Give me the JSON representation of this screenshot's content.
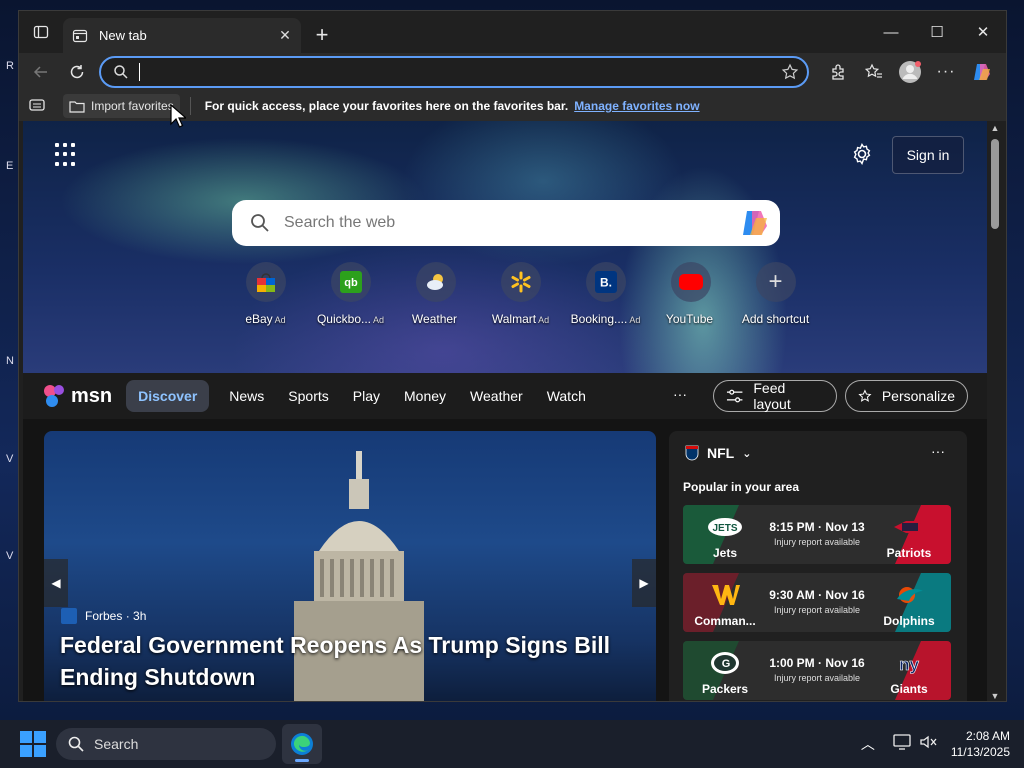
{
  "browser": {
    "tab_title": "New tab",
    "address_value": ""
  },
  "favorites_bar": {
    "import_label": "Import favorites",
    "message": "For quick access, place your favorites here on the favorites bar.",
    "manage_link": "Manage favorites now"
  },
  "newtab": {
    "signin_label": "Sign in",
    "search_placeholder": "Search the web",
    "shortcuts": [
      {
        "label": "eBay",
        "ad": "Ad"
      },
      {
        "label": "Quickbo...",
        "ad": "Ad"
      },
      {
        "label": "Weather",
        "ad": ""
      },
      {
        "label": "Walmart",
        "ad": "Ad"
      },
      {
        "label": "Booking....",
        "ad": "Ad"
      },
      {
        "label": "YouTube",
        "ad": ""
      },
      {
        "label": "Add shortcut",
        "ad": ""
      }
    ]
  },
  "msn": {
    "logo_text": "msn",
    "tabs": [
      "Discover",
      "News",
      "Sports",
      "Play",
      "Money",
      "Weather",
      "Watch"
    ],
    "more": "···",
    "feed_layout": "Feed layout",
    "personalize": "Personalize"
  },
  "hero_story": {
    "source": "Forbes",
    "age": "3h",
    "headline": "Federal Government Reopens As Trump Signs Bill Ending Shutdown"
  },
  "nfl": {
    "title": "NFL",
    "subtitle": "Popular in your area",
    "games": [
      {
        "team1": "Jets",
        "team2": "Patriots",
        "time": "8:15 PM · Nov 13",
        "note": "Injury report available",
        "color1": "#1a5a3a",
        "color2": "#c8102e"
      },
      {
        "team1": "Comman...",
        "team2": "Dolphins",
        "time": "9:30 AM · Nov 16",
        "note": "Injury report available",
        "color1": "#6b1f2a",
        "color2": "#0a7a80"
      },
      {
        "team1": "Packers",
        "team2": "Giants",
        "time": "1:00 PM · Nov 16",
        "note": "Injury report available",
        "color1": "#1f4a30",
        "color2": "#b8142c"
      }
    ]
  },
  "taskbar": {
    "search_label": "Search",
    "time": "2:08 AM",
    "date": "11/13/2025"
  },
  "colors": {
    "accent": "#5b9bf5",
    "link": "#7fb2ff"
  }
}
